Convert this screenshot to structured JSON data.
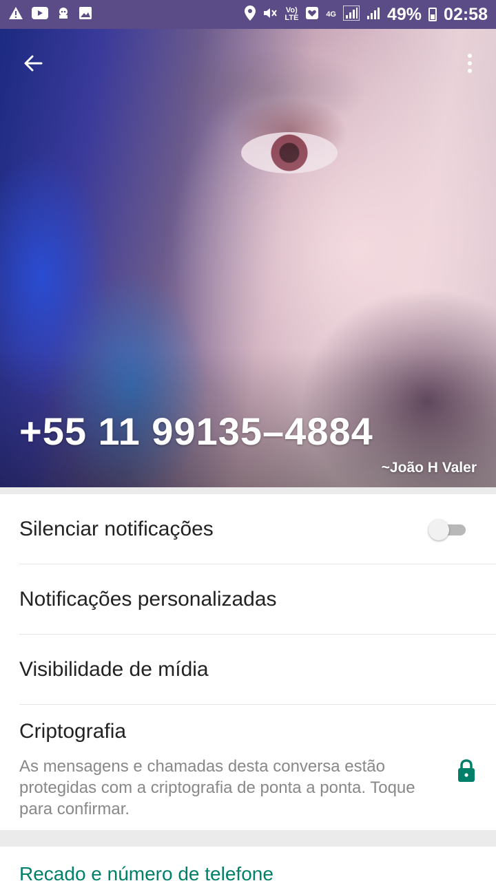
{
  "status_bar": {
    "battery": "49%",
    "time": "02:58",
    "volte_top": "Vo)",
    "volte_bottom": "LTE",
    "network": "4G",
    "icons": [
      "warning-icon",
      "youtube-icon",
      "bug-icon",
      "image-icon",
      "location-icon",
      "mute-icon",
      "volte-icon",
      "heart-icon",
      "network-icon",
      "signal-icon",
      "signal-icon",
      "battery-icon"
    ]
  },
  "header": {
    "phone_number": "+55 11 99135–4884",
    "push_name": "~João H Valer",
    "back_icon": "arrow-back-icon",
    "menu_icon": "more-vert-icon"
  },
  "settings": {
    "mute_label": "Silenciar notificações",
    "mute_enabled": false,
    "custom_notifications_label": "Notificações personalizadas",
    "media_visibility_label": "Visibilidade de mídia",
    "encryption_title": "Criptografia",
    "encryption_description": "As mensagens e chamadas desta conversa estão protegidas com a criptografia de ponta a ponta. Toque para confirmar.",
    "lock_icon": "lock-icon"
  },
  "section_about": {
    "title": "Recado e número de telefone"
  },
  "colors": {
    "status_bar": "#5b4b86",
    "accent": "#008069",
    "toggle_off_track": "#b8b8b8"
  }
}
